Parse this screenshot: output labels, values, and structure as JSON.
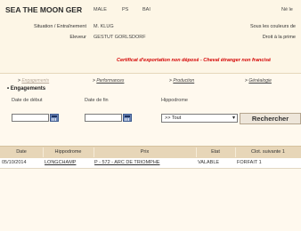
{
  "horse": {
    "name": "SEA THE MOON GER",
    "sex": "MALE",
    "coat": "PS",
    "color": "BAI",
    "birth_label": "Né le",
    "situation_label": "Situation / Entraînement",
    "situation_value": "M. KLUG",
    "breeder_label": "Eleveur",
    "breeder_value": "GESTUT GORLSDORF",
    "colors_label": "Sous les couleurs de",
    "prize_label": "Droit à la prime",
    "warning": "Certificat d'exportation non déposé - Cheval étranger non francisé"
  },
  "tabs": [
    {
      "label": "Engagements"
    },
    {
      "label": "Performances"
    },
    {
      "label": "Production"
    },
    {
      "label": "Généalogie"
    }
  ],
  "section_title": "• Engagements",
  "filters": {
    "start_label": "Date de début",
    "end_label": "Date de fin",
    "hippodrome_label": "Hippodrome",
    "hippodrome_value": ">> Tout",
    "search_button": "Rechercher"
  },
  "table": {
    "headers": [
      "Date",
      "Hippodrome",
      "Prix",
      "Etat",
      "Clot. suivante 1"
    ],
    "rows": [
      {
        "date": "05/10/2014",
        "hippodrome": "LONGCHAMP",
        "prix": "P - 572 - ARC DE TRIOMPHE",
        "etat": "VALABLE",
        "clot": "FORFAIT 1"
      }
    ]
  }
}
